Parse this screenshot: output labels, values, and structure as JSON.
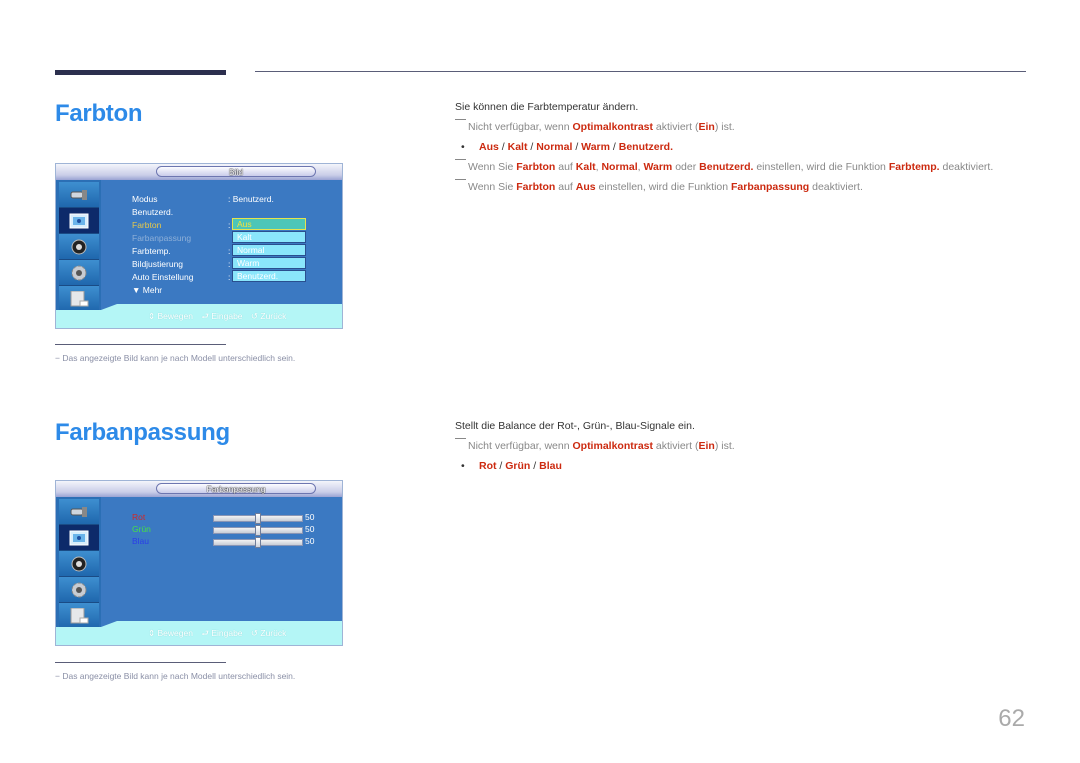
{
  "page_number": "62",
  "sections": [
    {
      "title": "Farbton",
      "description": "Sie können die Farbtemperatur ändern.",
      "note1": {
        "pre": "Nicht verfügbar, wenn ",
        "hl1": "Optimalkontrast",
        "mid": " aktiviert (",
        "hl2": "Ein",
        "post": ") ist."
      },
      "options": [
        "Aus",
        "Kalt",
        "Normal",
        "Warm",
        "Benutzerd."
      ],
      "note2": {
        "t1": "Wenn Sie ",
        "h1": "Farbton",
        "t2": " auf ",
        "h2": "Kalt",
        "t3": ", ",
        "h3": "Normal",
        "t4": ", ",
        "h4": "Warm",
        "t5": " oder ",
        "h5": "Benutzerd.",
        "t6": " einstellen, wird die Funktion ",
        "h6": "Farbtemp.",
        "t7": " deaktiviert."
      },
      "note3": {
        "t1": "Wenn Sie ",
        "h1": "Farbton",
        "t2": " auf ",
        "h2": "Aus",
        "t3": " einstellen, wird die Funktion ",
        "h3": "Farbanpassung",
        "t4": " deaktiviert."
      },
      "osd": {
        "title": "Bild",
        "menu": [
          {
            "label": "Modus",
            "value": ": Benutzerd.",
            "color": "#ffffff"
          },
          {
            "label": "Benutzerd.",
            "value": "",
            "color": "#ffffff"
          },
          {
            "label": "Farbton",
            "value": ":",
            "color": "#e8c94a"
          },
          {
            "label": "Farbanpassung",
            "value": "",
            "color": "#8fb0d8"
          },
          {
            "label": "Farbtemp.",
            "value": ":",
            "color": "#ffffff"
          },
          {
            "label": "Bildjustierung",
            "value": ":",
            "color": "#ffffff"
          },
          {
            "label": "Auto Einstellung",
            "value": ":",
            "color": "#ffffff"
          },
          {
            "label": "▼ Mehr",
            "value": "",
            "color": "#ffffff"
          }
        ],
        "dropdown": [
          "Aus",
          "Kalt",
          "Normal",
          "Warm",
          "Benutzerd."
        ],
        "dropdown_selected": "Aus"
      },
      "footnote": "−  Das angezeigte Bild kann je nach Modell unterschiedlich sein."
    },
    {
      "title": "Farbanpassung",
      "description": "Stellt die Balance der Rot-, Grün-, Blau-Signale ein.",
      "note1": {
        "pre": "Nicht verfügbar, wenn ",
        "hl1": "Optimalkontrast",
        "mid": " aktiviert (",
        "hl2": "Ein",
        "post": ") ist."
      },
      "options": [
        "Rot",
        "Grün",
        "Blau"
      ],
      "osd": {
        "title": "Farbanpassung",
        "sliders": [
          {
            "label": "Rot",
            "value": 50,
            "max": 100,
            "color": "#d02828"
          },
          {
            "label": "Grün",
            "value": 50,
            "max": 100,
            "color": "#46e046"
          },
          {
            "label": "Blau",
            "value": 50,
            "max": 100,
            "color": "#2a3de8"
          }
        ]
      },
      "footnote": "−  Das angezeigte Bild kann je nach Modell unterschiedlich sein."
    }
  ],
  "osd_footer": {
    "move": "⇕ Bewegen",
    "enter": "⮐ Eingabe",
    "back": "↺ Zurück"
  },
  "side_icons": [
    "input-icon",
    "picture-icon",
    "sound-icon",
    "setup-icon",
    "multi-control-icon"
  ]
}
